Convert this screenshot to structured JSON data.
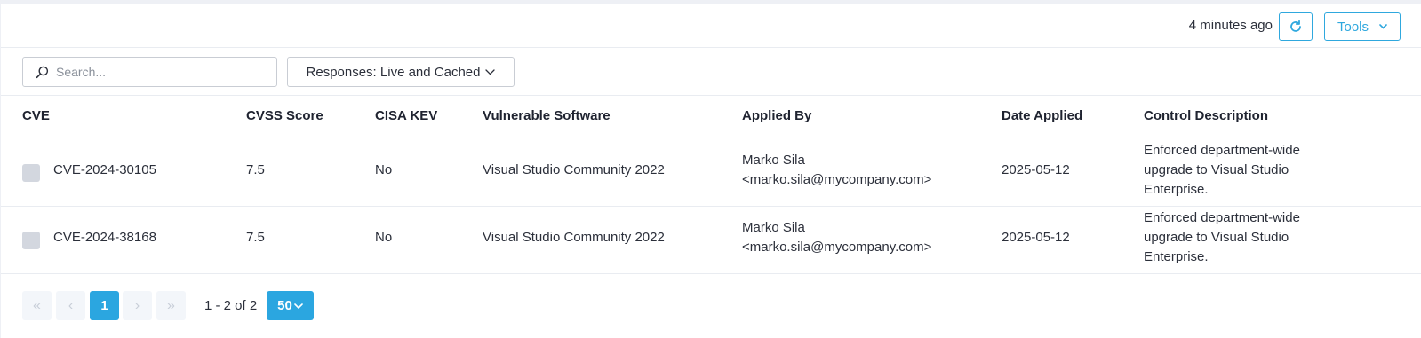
{
  "header": {
    "updated_text": "4 minutes ago",
    "tools_label": "Tools"
  },
  "filters": {
    "search_placeholder": "Search...",
    "responses_label": "Responses: Live and Cached"
  },
  "table": {
    "columns": [
      "CVE",
      "CVSS Score",
      "CISA KEV",
      "Vulnerable Software",
      "Applied By",
      "Date Applied",
      "Control Description"
    ],
    "rows": [
      {
        "cve": "CVE-2024-30105",
        "cvss": "7.5",
        "kev": "No",
        "software": "Visual Studio Community 2022",
        "applied_by_name": "Marko Sila",
        "applied_by_email": "<marko.sila@mycompany.com>",
        "date": "2025-05-12",
        "desc_line1": "Enforced department-wide",
        "desc_line2": "upgrade to Visual Studio",
        "desc_line3": "Enterprise."
      },
      {
        "cve": "CVE-2024-38168",
        "cvss": "7.5",
        "kev": "No",
        "software": "Visual Studio Community 2022",
        "applied_by_name": "Marko Sila",
        "applied_by_email": "<marko.sila@mycompany.com>",
        "date": "2025-05-12",
        "desc_line1": "Enforced department-wide",
        "desc_line2": "upgrade to Visual Studio",
        "desc_line3": "Enterprise."
      }
    ]
  },
  "pagination": {
    "first": "«",
    "prev": "‹",
    "current_page": "1",
    "next": "›",
    "last": "»",
    "range_text": "1 - 2 of 2",
    "per_page": "50"
  },
  "colors": {
    "accent": "#2ba6e0",
    "border": "#e9ecf1",
    "checkbox": "#d3d7df"
  },
  "icons": {
    "refresh": "refresh-icon",
    "tools_chevron": "chevron-down-icon",
    "search": "search-icon",
    "responses_chevron": "chevron-down-icon",
    "per_page_chevron": "chevron-down-icon"
  }
}
